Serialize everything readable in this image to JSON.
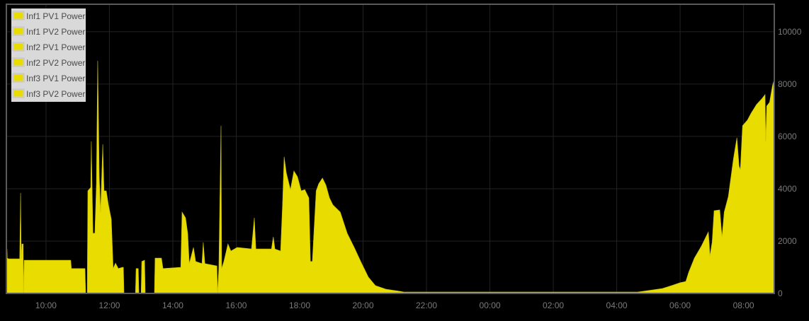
{
  "chart_data": {
    "type": "area",
    "title": "",
    "xlabel": "",
    "ylabel": "",
    "x_unit": "hours since start-day midnight (values above 24 are the next day)",
    "xlim": [
      8.75,
      32.97
    ],
    "ylim": [
      0,
      11050
    ],
    "grid": true,
    "legend_placement": "top-left",
    "legend": [
      "Inf1 PV1 Power",
      "Inf1 PV2 Power",
      "Inf2 PV1 Power",
      "Inf2 PV2 Power",
      "Inf3 PV1 Power",
      "Inf3 PV2 Power"
    ],
    "series_color": "#e8dc00",
    "x_ticks": [
      {
        "value": 10,
        "label": "10:00"
      },
      {
        "value": 12,
        "label": "12:00"
      },
      {
        "value": 14,
        "label": "14:00"
      },
      {
        "value": 16,
        "label": "16:00"
      },
      {
        "value": 18,
        "label": "18:00"
      },
      {
        "value": 20,
        "label": "20:00"
      },
      {
        "value": 22,
        "label": "22:00"
      },
      {
        "value": 24,
        "label": "00:00"
      },
      {
        "value": 26,
        "label": "02:00"
      },
      {
        "value": 28,
        "label": "04:00"
      },
      {
        "value": 30,
        "label": "06:00"
      },
      {
        "value": 32,
        "label": "08:00"
      }
    ],
    "y_ticks": [
      {
        "value": 0,
        "label": "0"
      },
      {
        "value": 2000,
        "label": "2000"
      },
      {
        "value": 4000,
        "label": "4000"
      },
      {
        "value": 6000,
        "label": "6000"
      },
      {
        "value": 8000,
        "label": "8000"
      },
      {
        "value": 10000,
        "label": "10000"
      }
    ],
    "points": [
      [
        8.75,
        1700
      ],
      [
        8.77,
        1700
      ],
      [
        8.78,
        1350
      ],
      [
        8.82,
        1320
      ],
      [
        9.17,
        1320
      ],
      [
        9.2,
        3840
      ],
      [
        9.22,
        1320
      ],
      [
        9.24,
        1890
      ],
      [
        9.28,
        1890
      ],
      [
        9.29,
        0
      ],
      [
        9.31,
        1270
      ],
      [
        9.33,
        1270
      ],
      [
        10.78,
        1270
      ],
      [
        10.8,
        950
      ],
      [
        11.23,
        950
      ],
      [
        11.25,
        0
      ],
      [
        11.3,
        0
      ],
      [
        11.32,
        3920
      ],
      [
        11.41,
        4050
      ],
      [
        11.43,
        5810
      ],
      [
        11.48,
        2300
      ],
      [
        11.54,
        2300
      ],
      [
        11.59,
        4190
      ],
      [
        11.63,
        8890
      ],
      [
        11.68,
        4460
      ],
      [
        11.72,
        3110
      ],
      [
        11.79,
        5700
      ],
      [
        11.83,
        3920
      ],
      [
        11.9,
        3920
      ],
      [
        11.97,
        3380
      ],
      [
        12.06,
        2840
      ],
      [
        12.12,
        950
      ],
      [
        12.19,
        1160
      ],
      [
        12.28,
        950
      ],
      [
        12.41,
        1000
      ],
      [
        12.44,
        1000
      ],
      [
        12.46,
        0
      ],
      [
        12.82,
        0
      ],
      [
        12.84,
        950
      ],
      [
        12.91,
        950
      ],
      [
        12.93,
        0
      ],
      [
        13.0,
        0
      ],
      [
        13.02,
        1220
      ],
      [
        13.11,
        1270
      ],
      [
        13.13,
        0
      ],
      [
        13.42,
        0
      ],
      [
        13.44,
        1350
      ],
      [
        13.64,
        1350
      ],
      [
        13.69,
        950
      ],
      [
        14.25,
        1000
      ],
      [
        14.29,
        3110
      ],
      [
        14.4,
        2890
      ],
      [
        14.47,
        2300
      ],
      [
        14.52,
        1140
      ],
      [
        14.65,
        1760
      ],
      [
        14.72,
        1220
      ],
      [
        14.92,
        1140
      ],
      [
        14.96,
        1950
      ],
      [
        15.01,
        1140
      ],
      [
        15.39,
        1050
      ],
      [
        15.41,
        0
      ],
      [
        15.45,
        950
      ],
      [
        15.52,
        6410
      ],
      [
        15.54,
        950
      ],
      [
        15.61,
        1220
      ],
      [
        15.74,
        1890
      ],
      [
        15.83,
        1620
      ],
      [
        16.03,
        1760
      ],
      [
        16.48,
        1700
      ],
      [
        16.57,
        2890
      ],
      [
        16.62,
        1700
      ],
      [
        17.11,
        1700
      ],
      [
        17.17,
        2160
      ],
      [
        17.22,
        1700
      ],
      [
        17.4,
        1620
      ],
      [
        17.46,
        3380
      ],
      [
        17.51,
        5220
      ],
      [
        17.58,
        4600
      ],
      [
        17.71,
        3970
      ],
      [
        17.82,
        4680
      ],
      [
        17.93,
        4460
      ],
      [
        18.05,
        3920
      ],
      [
        18.16,
        3970
      ],
      [
        18.29,
        3650
      ],
      [
        18.34,
        1220
      ],
      [
        18.4,
        1220
      ],
      [
        18.52,
        3920
      ],
      [
        18.6,
        4190
      ],
      [
        18.72,
        4410
      ],
      [
        18.83,
        4140
      ],
      [
        18.94,
        3650
      ],
      [
        19.05,
        3380
      ],
      [
        19.28,
        3110
      ],
      [
        19.5,
        2300
      ],
      [
        19.72,
        1760
      ],
      [
        19.95,
        1160
      ],
      [
        20.17,
        620
      ],
      [
        20.39,
        300
      ],
      [
        20.73,
        160
      ],
      [
        21.17,
        80
      ],
      [
        21.29,
        50
      ],
      [
        28.66,
        50
      ],
      [
        28.99,
        110
      ],
      [
        29.44,
        190
      ],
      [
        29.78,
        320
      ],
      [
        30.0,
        410
      ],
      [
        30.18,
        460
      ],
      [
        30.27,
        810
      ],
      [
        30.45,
        1350
      ],
      [
        30.67,
        1810
      ],
      [
        30.89,
        2350
      ],
      [
        30.92,
        1890
      ],
      [
        30.94,
        1430
      ],
      [
        31.01,
        1970
      ],
      [
        31.07,
        3160
      ],
      [
        31.25,
        3190
      ],
      [
        31.32,
        2160
      ],
      [
        31.39,
        3110
      ],
      [
        31.52,
        3700
      ],
      [
        31.68,
        5140
      ],
      [
        31.79,
        5950
      ],
      [
        31.86,
        4870
      ],
      [
        31.9,
        4730
      ],
      [
        31.97,
        6410
      ],
      [
        32.12,
        6620
      ],
      [
        32.24,
        6890
      ],
      [
        32.41,
        7220
      ],
      [
        32.57,
        7430
      ],
      [
        32.68,
        7600
      ],
      [
        32.7,
        5810
      ],
      [
        32.73,
        7160
      ],
      [
        32.82,
        7300
      ],
      [
        32.91,
        7920
      ],
      [
        32.97,
        8190
      ]
    ]
  }
}
